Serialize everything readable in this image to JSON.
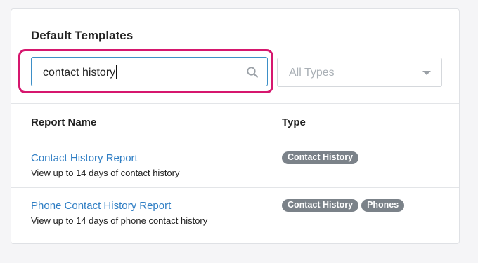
{
  "panel": {
    "title": "Default Templates"
  },
  "search": {
    "value": "contact history",
    "icon": "search-icon"
  },
  "type_filter": {
    "selected": "All Types",
    "icon": "chevron-down-icon"
  },
  "table": {
    "columns": [
      "Report Name",
      "Type"
    ],
    "rows": [
      {
        "name": "Contact History Report",
        "description": "View up to 14 days of contact history",
        "types": [
          "Contact History"
        ]
      },
      {
        "name": "Phone Contact History Report",
        "description": "View up to 14 days of phone contact history",
        "types": [
          "Contact History",
          "Phones"
        ]
      }
    ]
  },
  "colors": {
    "highlight": "#d6176e",
    "link": "#2f7ec4",
    "focus_border": "#3d8fc7",
    "badge_bg": "#7b8289"
  }
}
